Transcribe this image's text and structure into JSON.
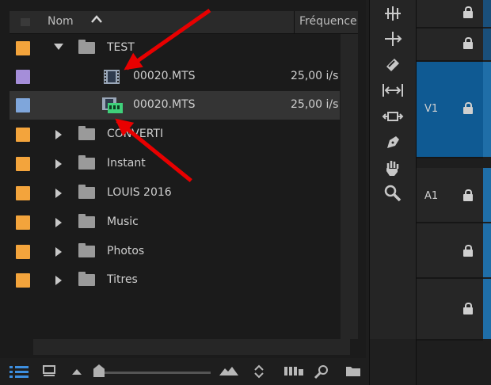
{
  "header": {
    "name_col": "Nom",
    "sort_indicator": "up-caret-icon",
    "freq_col": "Fréquence"
  },
  "rows": [
    {
      "name": "TEST",
      "color": "#f3a43c",
      "type": "folder",
      "expanded": true,
      "freq": ""
    },
    {
      "name": "00020.MTS",
      "color": "#a58ed9",
      "type": "video-clip",
      "freq": "25,00 i/s"
    },
    {
      "name": "00020.MTS",
      "color": "#7fa6db",
      "type": "multicam-clip",
      "freq": "25,00 i/s",
      "selected": true
    },
    {
      "name": "CONVERTI",
      "color": "#f3a43c",
      "type": "folder",
      "expanded": false,
      "freq": ""
    },
    {
      "name": "Instant",
      "color": "#f3a43c",
      "type": "folder",
      "expanded": false,
      "freq": ""
    },
    {
      "name": "LOUIS 2016",
      "color": "#f3a43c",
      "type": "folder",
      "expanded": false,
      "freq": ""
    },
    {
      "name": "Music",
      "color": "#f3a43c",
      "type": "folder",
      "expanded": false,
      "freq": ""
    },
    {
      "name": "Photos",
      "color": "#f3a43c",
      "type": "folder",
      "expanded": false,
      "freq": ""
    },
    {
      "name": "Titres",
      "color": "#f3a43c",
      "type": "folder",
      "expanded": false,
      "freq": ""
    }
  ],
  "tools": [
    "track-select-icon",
    "ripple-edit-icon",
    "razor-icon",
    "slip-icon",
    "slide-icon",
    "pen-icon",
    "hand-icon",
    "zoom-icon"
  ],
  "tracks": [
    {
      "label": "",
      "active": false
    },
    {
      "label": "",
      "active": false
    },
    {
      "label": "V1",
      "active": true
    },
    {
      "label": "A1",
      "active": false
    },
    {
      "label": "",
      "active": false
    },
    {
      "label": "",
      "active": false
    }
  ],
  "bottom_bar": [
    "list-view-icon",
    "icon-view-icon",
    "zoom-small-icon",
    "zoom-slider",
    "zoom-large-icon",
    "sort-icon",
    "automate-icon",
    "search-icon",
    "new-bin-icon"
  ],
  "zoom_level": 0.05
}
